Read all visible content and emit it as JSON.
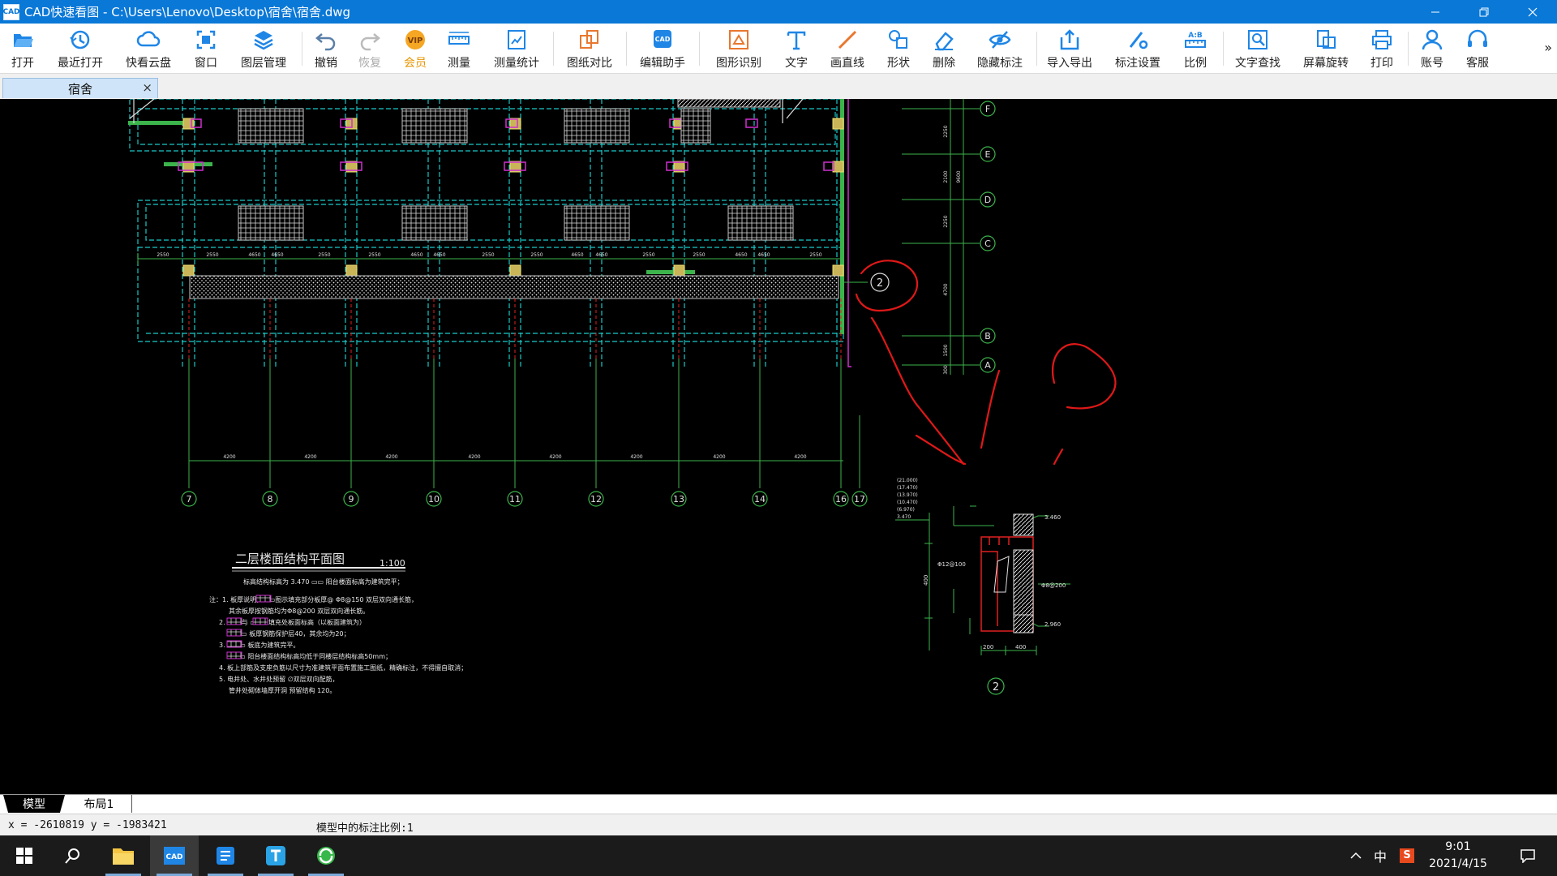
{
  "window": {
    "title": "CAD快速看图 - C:\\Users\\Lenovo\\Desktop\\宿舍\\宿舍.dwg",
    "app_icon_text": "CAD",
    "controls": [
      "minimize-icon",
      "restore-icon",
      "close-icon"
    ]
  },
  "toolbar": {
    "buttons": [
      {
        "label": "打开",
        "icon": "folder-open-icon"
      },
      {
        "label": "最近打开",
        "icon": "history-icon"
      },
      {
        "label": "快看云盘",
        "icon": "cloud-icon"
      },
      {
        "label": "窗口",
        "icon": "window-icon"
      },
      {
        "label": "图层管理",
        "icon": "layers-icon"
      },
      {
        "label": "撤销",
        "icon": "undo-icon"
      },
      {
        "label": "恢复",
        "icon": "redo-icon"
      },
      {
        "label": "会员",
        "icon": "vip-icon"
      },
      {
        "label": "测量",
        "icon": "ruler-icon"
      },
      {
        "label": "测量统计",
        "icon": "measure-stats-icon"
      },
      {
        "label": "图纸对比",
        "icon": "compare-icon"
      },
      {
        "label": "编辑助手",
        "icon": "edit-assistant-icon"
      },
      {
        "label": "图形识别",
        "icon": "shape-recognition-icon"
      },
      {
        "label": "文字",
        "icon": "text-icon"
      },
      {
        "label": "画直线",
        "icon": "line-icon"
      },
      {
        "label": "形状",
        "icon": "shape-icon"
      },
      {
        "label": "删除",
        "icon": "eraser-icon"
      },
      {
        "label": "隐藏标注",
        "icon": "hide-eye-icon"
      },
      {
        "label": "导入导出",
        "icon": "import-export-icon"
      },
      {
        "label": "标注设置",
        "icon": "annotation-settings-icon"
      },
      {
        "label": "比例",
        "icon": "scale-icon"
      },
      {
        "label": "文字查找",
        "icon": "text-search-icon"
      },
      {
        "label": "屏幕旋转",
        "icon": "rotate-icon"
      },
      {
        "label": "打印",
        "icon": "printer-icon"
      },
      {
        "label": "账号",
        "icon": "user-icon"
      },
      {
        "label": "客服",
        "icon": "headset-icon"
      }
    ],
    "more": "»"
  },
  "document_tab": {
    "label": "宿舍",
    "close": "×"
  },
  "drawing": {
    "row_axes": [
      "F",
      "E",
      "D",
      "C",
      "B",
      "A"
    ],
    "column_axes": [
      "7",
      "8",
      "9",
      "10",
      "11",
      "12",
      "13",
      "14",
      "16",
      "17"
    ],
    "col_dim_row": [
      "2550",
      "2550",
      "4650",
      "4650",
      "2550",
      "2550",
      "4650",
      "4650",
      "2550",
      "2550",
      "4650",
      "4650",
      "2550",
      "2550",
      "4650",
      "4650",
      "2550"
    ],
    "bottom_dims": [
      "4200",
      "4200",
      "4200",
      "4200",
      "4200",
      "4200",
      "4200",
      "4200"
    ],
    "right_dims": [
      "2250",
      "2100",
      "2250",
      "4700",
      "1500",
      "300"
    ],
    "right_total": "9600",
    "section_callout": "2",
    "plan_title": "二层楼面结构平面图",
    "plan_scale": "1:100",
    "plan_subtitle": "标高结构标高为  3.470   ▭▭ 阳台楼面标高为建筑完平；",
    "notes": [
      "注：1. 板厚说明，▭▭图示填充部分板厚@ Φ8@150 双层双向通长筋，",
      "其余板厚按钢筋均为Φ8@200 双层双向通长筋。",
      "2. ▭▭ 与 ▭▭▭填充处板面标高（以板面建筑为）",
      "▭▭▭ 板厚钢筋保护层40，其余均为20；",
      "3. ▭▭▭ 板底为建筑完平。",
      "▭▭▭ 阳台楼面结构标高均低于同楼层结构标高50mm；",
      "4. 板上部筋及支座负筋以尺寸为准建筑平面布置施工图纸，精确标注，不得擅自取消；",
      "5. 电井处、水井处预留     ∅双层双向配筋，",
      "   管井处砌体墙厚开洞     预留结构     120。"
    ],
    "section_labels": {
      "elevations": [
        "(21.000)",
        "(17.470)",
        "(13.970)",
        "(10.470)",
        "(6.970)",
        "3.470"
      ],
      "rebar_top": "Φ12@100",
      "rebar_right": "Φ8@200",
      "elev_right_top": "3.460",
      "elev_right_bottom": "2.960",
      "dim_v": "400",
      "dim_h_left": "200",
      "dim_h_right": "400"
    },
    "section_number": "2"
  },
  "layout_tabs": {
    "model": "模型",
    "layout1": "布局1"
  },
  "status": {
    "coords": "x = -2610819 y = -1983421",
    "scale_text": "模型中的标注比例:1"
  },
  "taskbar": {
    "apps": [
      "start-icon",
      "search-icon",
      "file-explorer-icon",
      "cad-viewer-icon",
      "document-app-icon",
      "text-app-icon",
      "browser-icon"
    ],
    "tray_ime": "中",
    "tray_sogou": "S",
    "time": "9:01",
    "date": "2021/4/15"
  }
}
